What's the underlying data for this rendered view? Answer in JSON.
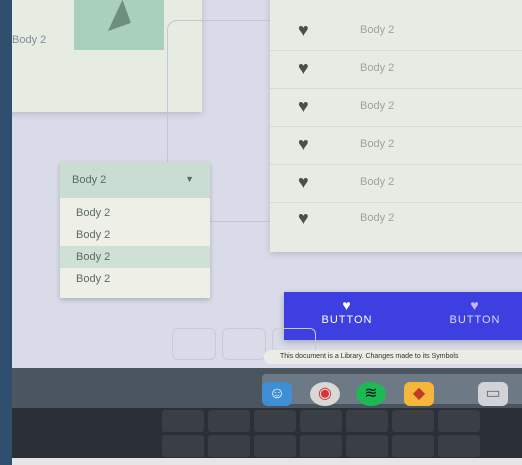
{
  "card": {
    "label": "Body 2"
  },
  "list": {
    "items": [
      {
        "label": "Body 2"
      },
      {
        "label": "Body 2"
      },
      {
        "label": "Body 2"
      },
      {
        "label": "Body 2"
      },
      {
        "label": "Body 2"
      },
      {
        "label": "Body 2"
      }
    ]
  },
  "dropdown": {
    "selected": "Body 2",
    "options": [
      "Body 2",
      "Body 2",
      "Body 2",
      "Body 2"
    ]
  },
  "buttons": [
    "BUTTON",
    "BUTTON"
  ],
  "notice": "This document is a Library. Changes made to its Symbols",
  "dock": {
    "icons": [
      "finder-icon",
      "chrome-icon",
      "spotify-icon",
      "sketch-icon",
      "drive-icon"
    ]
  },
  "colors": {
    "button_bar": "#3d3fe0",
    "dropdown_selected": "#cfe1d6"
  }
}
